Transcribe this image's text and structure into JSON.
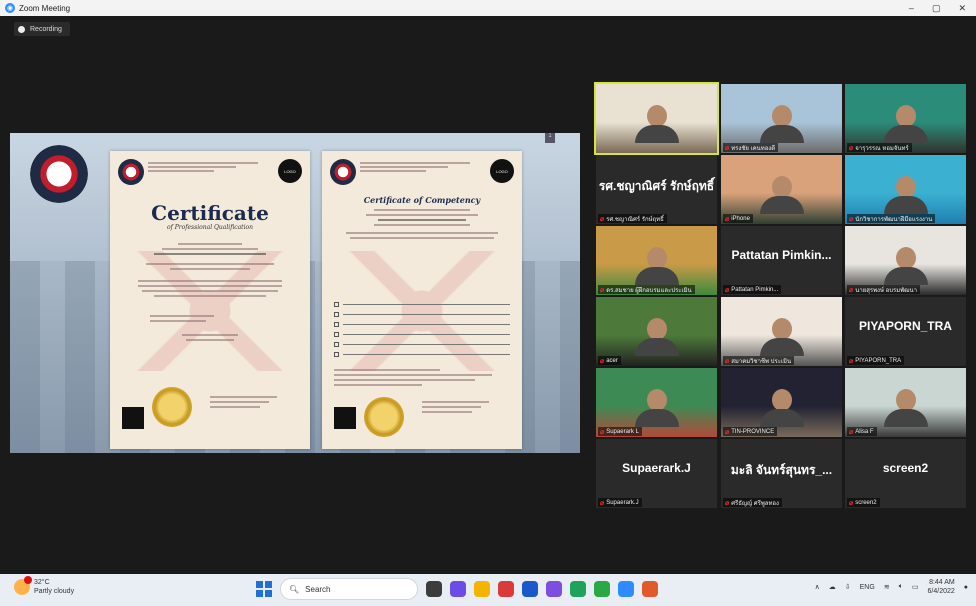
{
  "window": {
    "title": "Zoom Meeting",
    "controls": [
      "–",
      "▢",
      "✕"
    ]
  },
  "recording": {
    "label": "Recording"
  },
  "share": {
    "page_indicator": "1",
    "cert1": {
      "title": "Certificate",
      "subtitle": "of Professional Qualification",
      "logo_text": "LOGO"
    },
    "cert2": {
      "title": "Certificate of Competency",
      "logo_text": "LOGO"
    }
  },
  "gallery": {
    "tiles": [
      {
        "name": "",
        "kind": "video",
        "active": true,
        "colors": [
          "#e9e2d3",
          "#7a6a55"
        ]
      },
      {
        "name": "ทรงชัย เคนทองดี",
        "kind": "video",
        "colors": [
          "#a9c4d9",
          "#6b6b6b"
        ]
      },
      {
        "name": "จารุวรรณ หอมจันทร์",
        "kind": "video",
        "colors": [
          "#2c8c7a",
          "#30332f"
        ]
      },
      {
        "name": "รศ.ชญาณิศร์ รักษ์ฤทธิ์",
        "kind": "name",
        "label": "รศ.ชญาณิศร์ รักษ์ฤทธิ์"
      },
      {
        "name": "iPhone",
        "kind": "video",
        "colors": [
          "#d9a27a",
          "#2f3f33"
        ]
      },
      {
        "name": "นักวิชาการพัฒนาฝีมือแรงงาน",
        "kind": "video",
        "colors": [
          "#3bb0d1",
          "#1e7fb0"
        ]
      },
      {
        "name": "ดร.สมชาย ผู้ฝึกอบรมและประเมิน",
        "kind": "video",
        "colors": [
          "#c99a48",
          "#3d8a3c"
        ]
      },
      {
        "name": "Pattatan Pimkin...",
        "kind": "name",
        "label": "Pattatan Pimkin..."
      },
      {
        "name": "นายสุรพงษ์ อบรมพัฒนา",
        "kind": "video",
        "colors": [
          "#e8e5e0",
          "#2a2a2a"
        ]
      },
      {
        "name": "acer",
        "kind": "video",
        "colors": [
          "#4d7a3a",
          "#222"
        ]
      },
      {
        "name": "สมาคมวิชาชีพ ประเมิน",
        "kind": "video",
        "colors": [
          "#efe7de",
          "#555"
        ]
      },
      {
        "name": "PIYAPORN_TRA",
        "kind": "name",
        "label": "PIYAPORN_TRA"
      },
      {
        "name": "Supaerark L",
        "kind": "video",
        "colors": [
          "#3e8a55",
          "#b24a3a"
        ]
      },
      {
        "name": "TIN-PROVINCE",
        "kind": "video",
        "colors": [
          "#223",
          "#7a6a5a"
        ]
      },
      {
        "name": "Alisa F",
        "kind": "video",
        "colors": [
          "#c9d6d1",
          "#3a3a3a"
        ]
      },
      {
        "name": "Supaerark.J",
        "kind": "name",
        "label": "Supaerark.J"
      },
      {
        "name": "ศรีธัญญ์ ศรีพูลทอง",
        "kind": "name",
        "label": "มะลิ จันทร์สุนทร_..."
      },
      {
        "name": "screen2",
        "kind": "name",
        "label": "screen2"
      }
    ]
  },
  "taskbar": {
    "weather": {
      "temp": "32°C",
      "desc": "Partly cloudy"
    },
    "search_placeholder": "Search",
    "lang": "ENG",
    "time": "8:44 AM",
    "date": "6/4/2022",
    "icon_colors": [
      "#3c3c3c",
      "#6b4de6",
      "#f4b400",
      "#d93b3b",
      "#1b59c9",
      "#7c4de0",
      "#1fa35b",
      "#2aa844",
      "#2d8cff",
      "#e05a2b"
    ]
  }
}
